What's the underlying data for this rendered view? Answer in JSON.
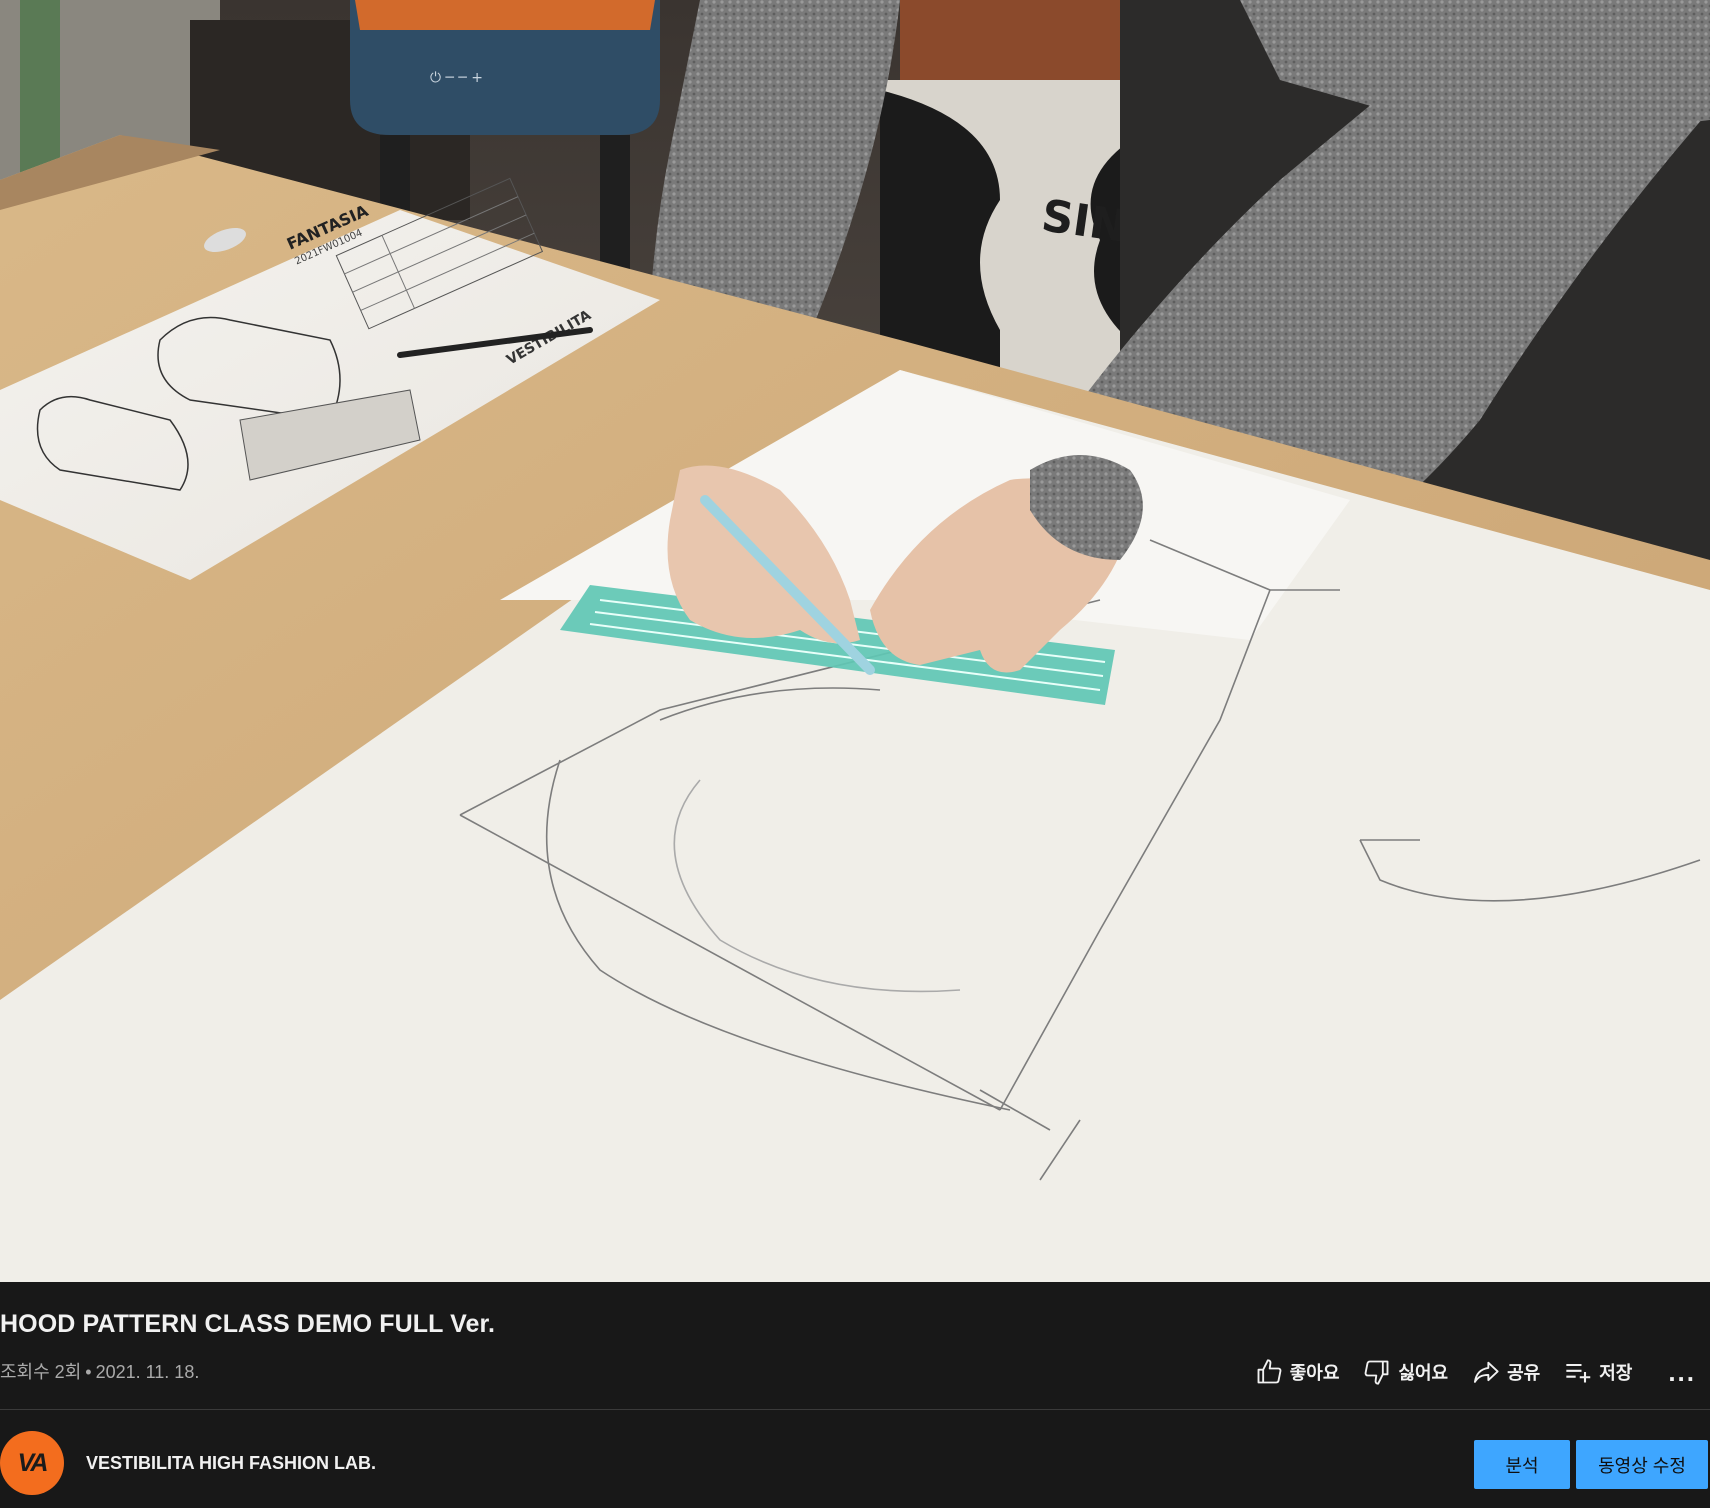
{
  "video": {
    "title": "HOOD PATTERN CLASS DEMO FULL Ver.",
    "views": "조회수 2회",
    "date": "2021. 11. 18.",
    "scene_text": {
      "sheet_title": "FANTASIA",
      "sheet_code": "2021FW01004",
      "machine_brand": "SINGER",
      "sheet_logo": "VESTIBILITA"
    }
  },
  "actions": {
    "like_label": "좋아요",
    "dislike_label": "싫어요",
    "share_label": "공유",
    "save_label": "저장",
    "more_label": "..."
  },
  "channel": {
    "avatar_text": "VA",
    "name": "VESTIBILITA HIGH FASHION LAB."
  },
  "buttons": {
    "analytics_label": "분석",
    "edit_label": "동영상 수정"
  },
  "colors": {
    "background": "#181818",
    "text_primary": "#f1f1f1",
    "text_secondary": "#aaaaaa",
    "button_blue": "#3ea6ff",
    "avatar_orange": "#f36d1e"
  },
  "icons": {
    "like": "thumb-up-icon",
    "dislike": "thumb-down-icon",
    "share": "share-arrow-icon",
    "save": "playlist-add-icon",
    "more": "more-horizontal-icon"
  }
}
